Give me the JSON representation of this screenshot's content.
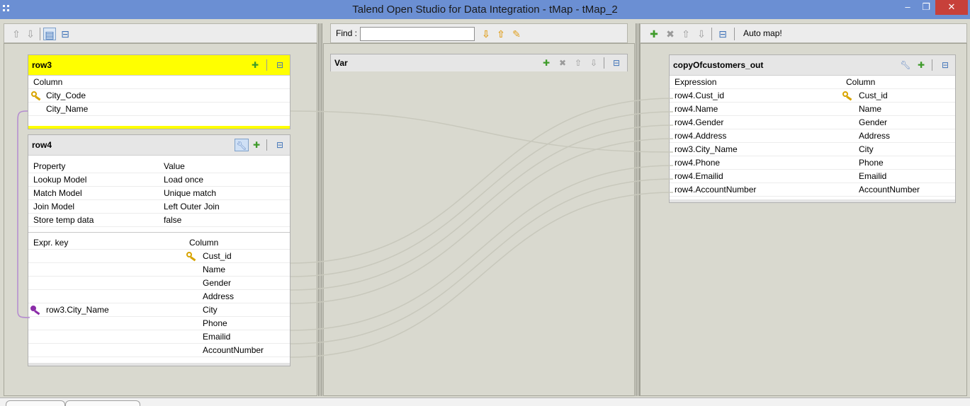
{
  "window": {
    "title": "Talend Open Studio for Data Integration - tMap - tMap_2",
    "minimize": "–",
    "maximize": "❐",
    "close": "✕"
  },
  "toolbar_left": {
    "icons": [
      "up-arrow-icon",
      "down-arrow-icon",
      "table-view-icon",
      "minimize-icon"
    ]
  },
  "toolbar_mid": {
    "find_label": "Find :",
    "find_value": ""
  },
  "toolbar_right": {
    "auto_map_label": "Auto map!"
  },
  "row3": {
    "name": "row3",
    "column_header": "Column",
    "columns": [
      {
        "name": "City_Code",
        "key": true
      },
      {
        "name": "City_Name",
        "key": false
      }
    ]
  },
  "row4": {
    "name": "row4",
    "property_header": "Property",
    "value_header": "Value",
    "properties": [
      {
        "property": "Lookup Model",
        "value": "Load once"
      },
      {
        "property": "Match Model",
        "value": "Unique match"
      },
      {
        "property": "Join Model",
        "value": "Left Outer Join"
      },
      {
        "property": "Store temp data",
        "value": "false"
      }
    ],
    "expr_header": "Expr. key",
    "column_header": "Column",
    "rows": [
      {
        "expr": "",
        "column": "Cust_id",
        "key": true
      },
      {
        "expr": "",
        "column": "Name"
      },
      {
        "expr": "",
        "column": "Gender"
      },
      {
        "expr": "",
        "column": "Address"
      },
      {
        "expr": "row3.City_Name",
        "column": "City",
        "join_key": true
      },
      {
        "expr": "",
        "column": "Phone"
      },
      {
        "expr": "",
        "column": "Emailid"
      },
      {
        "expr": "",
        "column": "AccountNumber"
      }
    ]
  },
  "var": {
    "name": "Var"
  },
  "output": {
    "name": "copyOfcustomers_out",
    "expression_header": "Expression",
    "column_header": "Column",
    "rows": [
      {
        "expression": "row4.Cust_id",
        "column": "Cust_id",
        "key": true
      },
      {
        "expression": "row4.Name",
        "column": "Name"
      },
      {
        "expression": "row4.Gender",
        "column": "Gender"
      },
      {
        "expression": "row4.Address",
        "column": "Address"
      },
      {
        "expression": "row3.City_Name",
        "column": "City"
      },
      {
        "expression": "row4.Phone",
        "column": "Phone"
      },
      {
        "expression": "row4.Emailid",
        "column": "Emailid"
      },
      {
        "expression": "row4.AccountNumber",
        "column": "AccountNumber"
      }
    ]
  },
  "colors": {
    "titlebar": "#6b8fd3",
    "row3_header": "#ffff00",
    "link": "#c8c8bc",
    "join_link": "#b48ad0"
  }
}
